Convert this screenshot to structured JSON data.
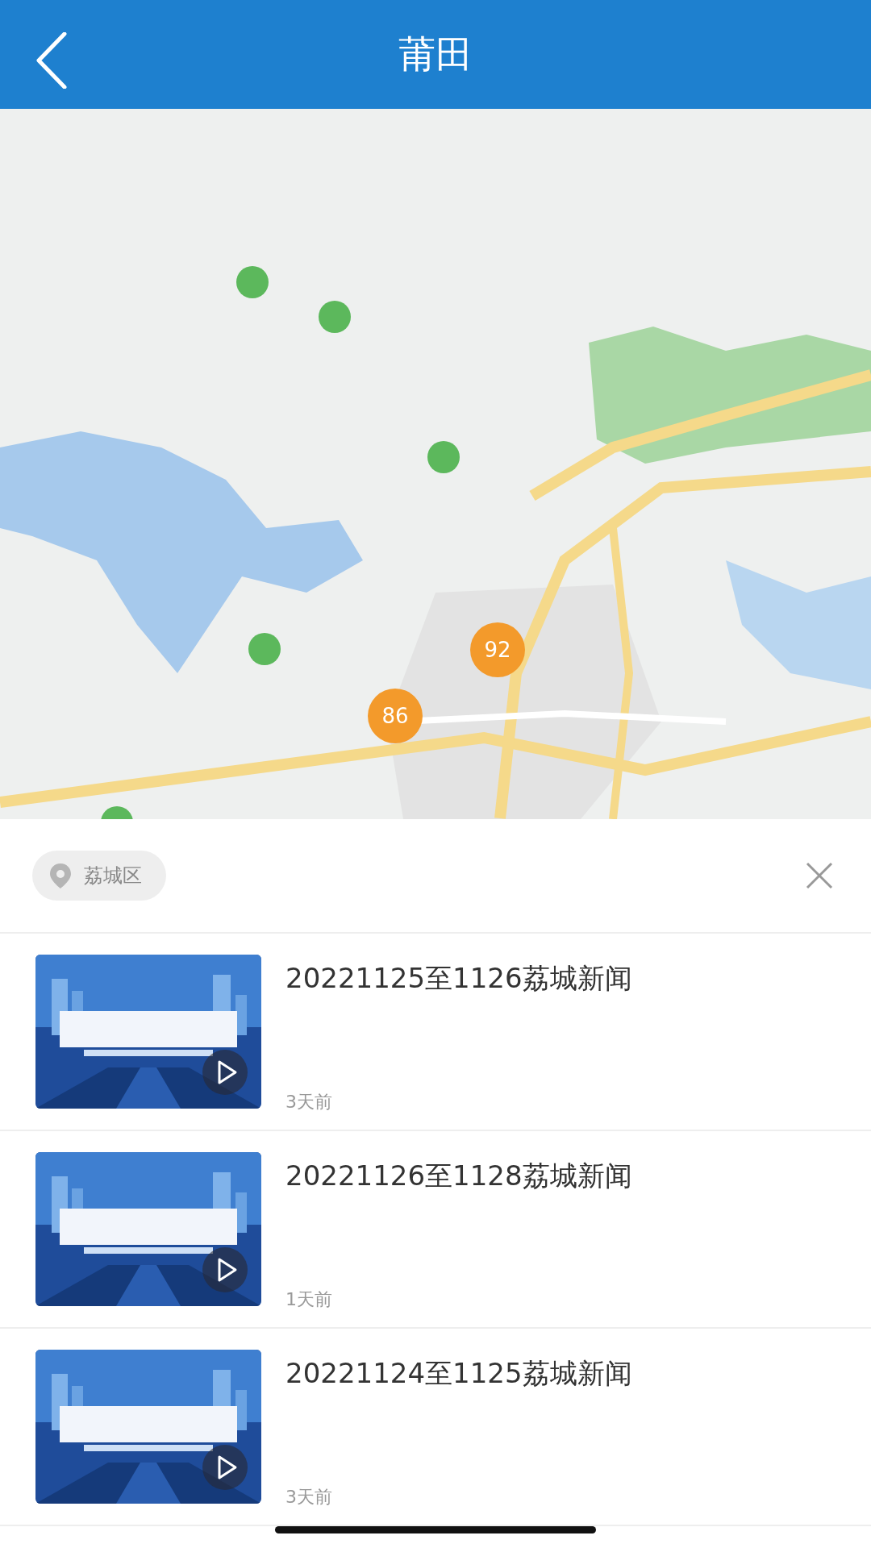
{
  "header": {
    "title": "莆田"
  },
  "map": {
    "kind": "picture",
    "markers": [
      {
        "label": "92"
      },
      {
        "label": "86"
      }
    ]
  },
  "filter": {
    "chip": "荔城区"
  },
  "items": [
    {
      "title": "20221125至1126荔城新闻",
      "time": "3天前"
    },
    {
      "title": "20221126至1128荔城新闻",
      "time": "1天前"
    },
    {
      "title": "20221124至1125荔城新闻",
      "time": "3天前"
    }
  ]
}
